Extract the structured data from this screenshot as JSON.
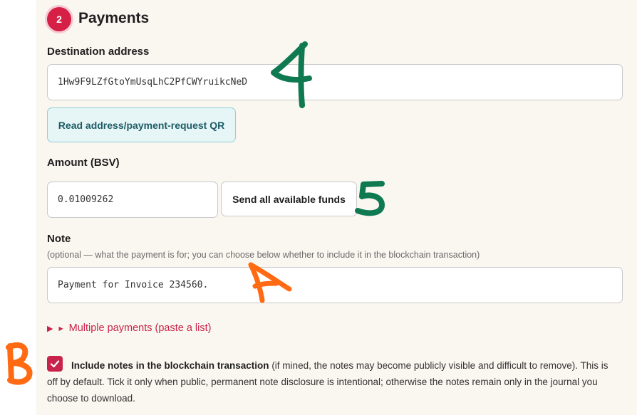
{
  "section": {
    "step_number": "2",
    "title": "Payments"
  },
  "destination": {
    "label": "Destination address",
    "value": "1Hw9F9LZfGtoYmUsqLhC2PfCWYruikcNeD",
    "qr_button_label": "Read address/payment-request QR"
  },
  "amount": {
    "label": "Amount (BSV)",
    "value": "0.01009262",
    "send_all_label": "Send all available funds"
  },
  "note": {
    "label": "Note",
    "hint": "(optional — what the payment is for; you can choose below whether to include it in the blockchain transaction)",
    "value": "Payment for Invoice 234560."
  },
  "multiple_payments": {
    "label": "Multiple payments (paste a list)"
  },
  "include_notes": {
    "checked": true,
    "label_bold": "Include notes in the blockchain transaction",
    "label_rest": " (if mined, the notes may become publicly visible and difficult to remove). This is off by default. Tick it only when public, permanent note disclosure is intentional; otherwise the notes remain only in the journal you choose to download."
  },
  "annotations": {
    "dest": "4",
    "amount": "5",
    "note": "A",
    "checkbox": "B"
  },
  "colors": {
    "accent": "#c8234a",
    "badge": "#d61f45",
    "qr_button_bg": "#e6f6f7",
    "annotation_green": "#0f7a52",
    "annotation_orange": "#ff6a13"
  }
}
